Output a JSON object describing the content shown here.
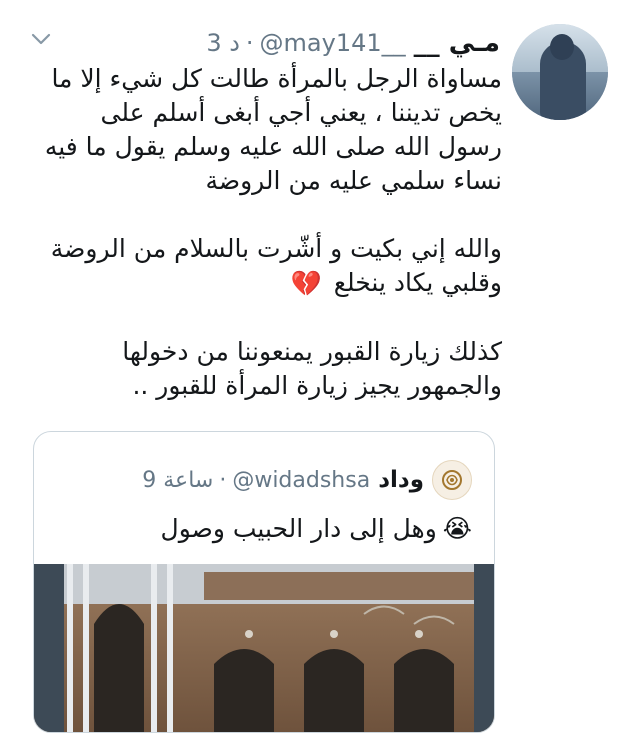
{
  "tweet": {
    "author_name": "مـي __",
    "handle": "@may141__",
    "time": "3 د",
    "separator": "·",
    "paragraphs": [
      [
        "مساواة الرجل بالمرأة طالت كل شيء إلا ما",
        "يخص تديننا ، يعني أجي أبغى أسلم على",
        "رسول الله صلى الله عليه وسلم يقول ما فيه",
        "نساء سلمي عليه من الروضة"
      ],
      [
        "والله إني بكيت و أشّرت بالسلام من الروضة",
        "وقلبي يكاد ينخلع"
      ],
      [
        "كذلك زيارة القبور يمنعوننا من دخولها",
        "والجمهور يجيز زيارة المرأة للقبور .."
      ]
    ],
    "emoji_broken_heart": "💔"
  },
  "quoted": {
    "author_name": "وداد",
    "handle": "@widadshsa",
    "time": "9 ساعة",
    "separator": "·",
    "text": "وهل إلى دار الحبيب وصول",
    "emoji_crying": "😭"
  },
  "colors": {
    "text": "#14171a",
    "secondary": "#657786",
    "border": "#ccd6dd"
  },
  "icons": {
    "menu": "chevron-down-icon"
  }
}
